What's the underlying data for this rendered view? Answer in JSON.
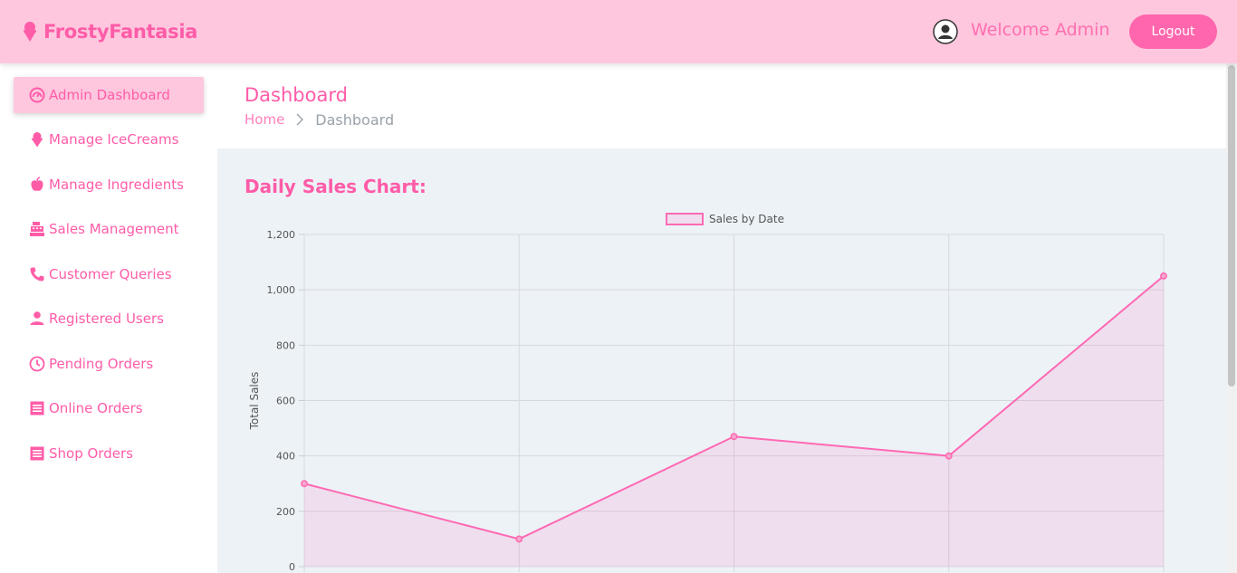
{
  "header": {
    "brand": "FrostyFantasia",
    "welcome": "Welcome Admin",
    "logout_label": "Logout"
  },
  "sidebar": {
    "items": [
      {
        "label": "Admin Dashboard",
        "icon": "dashboard-icon",
        "active": true
      },
      {
        "label": "Manage IceCreams",
        "icon": "ice-cream-icon"
      },
      {
        "label": "Manage Ingredients",
        "icon": "apple-icon"
      },
      {
        "label": "Sales Management",
        "icon": "cash-register-icon"
      },
      {
        "label": "Customer Queries",
        "icon": "phone-icon"
      },
      {
        "label": "Registered Users",
        "icon": "person-icon"
      },
      {
        "label": "Pending Orders",
        "icon": "clock-icon"
      },
      {
        "label": "Online Orders",
        "icon": "list-icon"
      },
      {
        "label": "Shop Orders",
        "icon": "list-icon"
      }
    ]
  },
  "page": {
    "title": "Dashboard",
    "breadcrumb": {
      "home": "Home",
      "current": "Dashboard"
    }
  },
  "main": {
    "chart_heading": "Daily Sales Chart:"
  },
  "colors": {
    "accent": "#ff5ca8",
    "header_bg": "#ffc7de",
    "button_bg": "#ff66ad",
    "content_bg": "#edf2f7",
    "line": "#ff69b4"
  },
  "chart_data": {
    "type": "area",
    "series": [
      {
        "name": "Sales by Date",
        "values": [
          300,
          100,
          470,
          400,
          1050
        ]
      }
    ],
    "ylabel": "Total Sales",
    "ylim": [
      0,
      1200
    ],
    "yticks": [
      "0",
      "200",
      "400",
      "600",
      "800",
      "1,000",
      "1,200"
    ],
    "grid": true,
    "legend": "top-center"
  }
}
